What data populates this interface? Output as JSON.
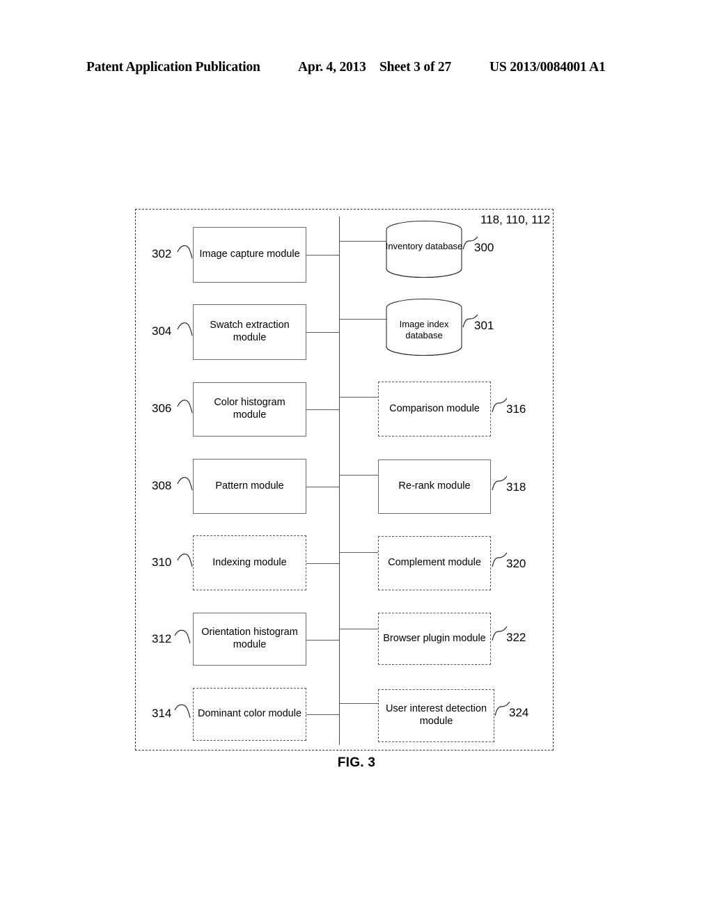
{
  "header": {
    "publication": "Patent Application Publication",
    "date": "Apr. 4, 2013",
    "sheet": "Sheet 3 of 27",
    "patent_number": "US 2013/0084001 A1"
  },
  "figure": {
    "caption": "FIG. 3",
    "group_label": "118, 110, 112"
  },
  "left_modules": [
    {
      "ref": "302",
      "label": "Image capture module"
    },
    {
      "ref": "304",
      "label": "Swatch extraction module"
    },
    {
      "ref": "306",
      "label": "Color histogram module"
    },
    {
      "ref": "308",
      "label": "Pattern module"
    },
    {
      "ref": "310",
      "label": "Indexing module"
    },
    {
      "ref": "312",
      "label": "Orientation histogram module"
    },
    {
      "ref": "314",
      "label": "Dominant color module"
    }
  ],
  "databases": [
    {
      "ref": "300",
      "label": "Inventory database"
    },
    {
      "ref": "301",
      "label": "Image index database"
    }
  ],
  "right_modules": [
    {
      "ref": "316",
      "label": "Comparison module"
    },
    {
      "ref": "318",
      "label": "Re-rank module"
    },
    {
      "ref": "320",
      "label": "Complement module"
    },
    {
      "ref": "322",
      "label": "Browser plugin module"
    },
    {
      "ref": "324",
      "label": "User interest detection module"
    }
  ]
}
